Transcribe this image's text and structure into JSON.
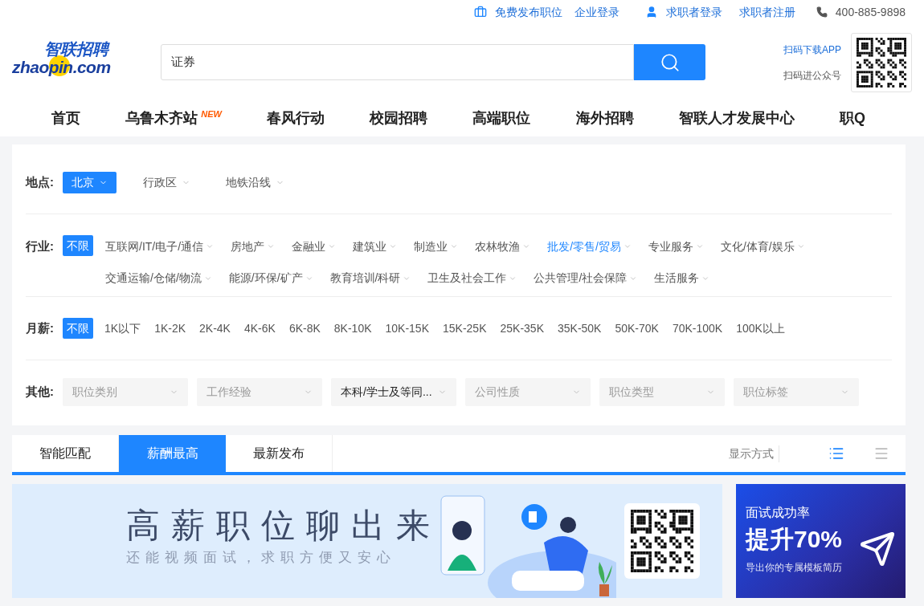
{
  "top_bar": {
    "post_job": "免费发布职位",
    "company_login": "企业登录",
    "seeker_login": "求职者登录",
    "seeker_register": "求职者注册",
    "phone": "400-885-9898"
  },
  "logo": {
    "cn": "智联招聘",
    "en": "zhaopin.com"
  },
  "search": {
    "value": "证券"
  },
  "qr": {
    "download_app": "扫码下载APP",
    "follow": "扫码进公众号"
  },
  "nav": [
    {
      "label": "首页"
    },
    {
      "label": "乌鲁木齐站",
      "badge": "NEW"
    },
    {
      "label": "春风行动"
    },
    {
      "label": "校园招聘"
    },
    {
      "label": "高端职位"
    },
    {
      "label": "海外招聘"
    },
    {
      "label": "智联人才发展中心"
    },
    {
      "label": "职Q"
    }
  ],
  "filters": {
    "location": {
      "label": "地点:",
      "options": [
        {
          "text": "北京",
          "selected": true
        },
        {
          "text": "行政区",
          "selected": false
        },
        {
          "text": "地铁沿线",
          "selected": false
        }
      ]
    },
    "industry": {
      "label": "行业:",
      "all": {
        "text": "不限",
        "selected": true
      },
      "options": [
        {
          "text": "互联网/IT/电子/通信",
          "highlighted": false
        },
        {
          "text": "房地产",
          "highlighted": false
        },
        {
          "text": "金融业",
          "highlighted": false
        },
        {
          "text": "建筑业",
          "highlighted": false
        },
        {
          "text": "制造业",
          "highlighted": false
        },
        {
          "text": "农林牧渔",
          "highlighted": false
        },
        {
          "text": "批发/零售/贸易",
          "highlighted": true
        },
        {
          "text": "专业服务",
          "highlighted": false
        },
        {
          "text": "文化/体育/娱乐",
          "highlighted": false
        },
        {
          "text": "交通运输/仓储/物流",
          "highlighted": false
        },
        {
          "text": "能源/环保/矿产",
          "highlighted": false
        },
        {
          "text": "教育培训/科研",
          "highlighted": false
        },
        {
          "text": "卫生及社会工作",
          "highlighted": false
        },
        {
          "text": "公共管理/社会保障",
          "highlighted": false
        },
        {
          "text": "生活服务",
          "highlighted": false
        }
      ]
    },
    "salary": {
      "label": "月薪:",
      "options": [
        {
          "text": "不限",
          "selected": true
        },
        {
          "text": "1K以下",
          "selected": false
        },
        {
          "text": "1K-2K",
          "selected": false
        },
        {
          "text": "2K-4K",
          "selected": false
        },
        {
          "text": "4K-6K",
          "selected": false
        },
        {
          "text": "6K-8K",
          "selected": false
        },
        {
          "text": "8K-10K",
          "selected": false
        },
        {
          "text": "10K-15K",
          "selected": false
        },
        {
          "text": "15K-25K",
          "selected": false
        },
        {
          "text": "25K-35K",
          "selected": false
        },
        {
          "text": "35K-50K",
          "selected": false
        },
        {
          "text": "50K-70K",
          "selected": false
        },
        {
          "text": "70K-100K",
          "selected": false
        },
        {
          "text": "100K以上",
          "selected": false
        }
      ]
    },
    "other": {
      "label": "其他:",
      "dropdowns": [
        {
          "placeholder": "职位类别"
        },
        {
          "placeholder": "工作经验"
        },
        {
          "value": "本科/学士及等同..."
        },
        {
          "placeholder": "公司性质"
        },
        {
          "placeholder": "职位类型"
        },
        {
          "placeholder": "职位标签"
        }
      ]
    }
  },
  "tabs": [
    {
      "label": "智能匹配",
      "selected": false
    },
    {
      "label": "薪酬最高",
      "selected": true
    },
    {
      "label": "最新发布",
      "selected": false
    }
  ],
  "view": {
    "label": "显示方式",
    "modes": [
      {
        "kind": "grid",
        "selected": true
      },
      {
        "kind": "list",
        "selected": false
      }
    ]
  },
  "banner": {
    "title": "高薪职位聊出来",
    "subtitle": "还能视频面试，求职方便又安心"
  },
  "ad": {
    "line1": "面试成功率",
    "line2": "提升70%",
    "line3": "导出你的专属模板简历"
  }
}
